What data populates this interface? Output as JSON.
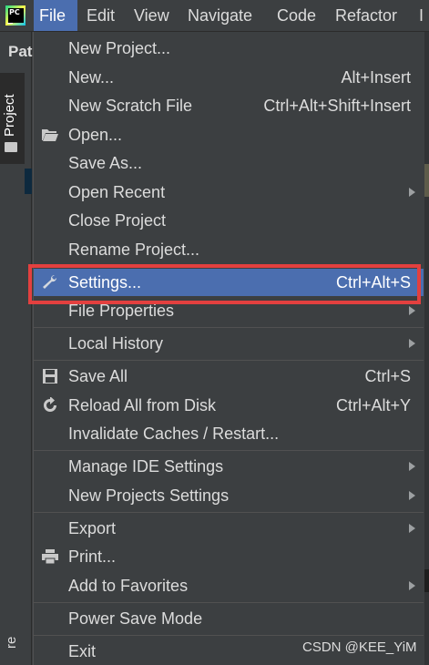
{
  "app": {
    "logo_text": "PC"
  },
  "menubar": {
    "items": [
      {
        "label": "File"
      },
      {
        "label": "Edit"
      },
      {
        "label": "View"
      },
      {
        "label": "Navigate"
      },
      {
        "label": "Code"
      },
      {
        "label": "Refactor"
      },
      {
        "label": "I"
      }
    ]
  },
  "background": {
    "pat_label": "Pat",
    "project_tab": "Project",
    "re_label": "re"
  },
  "file_menu": {
    "new_project": {
      "label": "New Project..."
    },
    "new": {
      "label": "New...",
      "shortcut": "Alt+Insert"
    },
    "new_scratch": {
      "label": "New Scratch File",
      "shortcut": "Ctrl+Alt+Shift+Insert"
    },
    "open": {
      "label": "Open...",
      "icon": "folder-open-icon"
    },
    "save_as": {
      "label": "Save As..."
    },
    "open_recent": {
      "label": "Open Recent"
    },
    "close_project": {
      "label": "Close Project"
    },
    "rename_project": {
      "label": "Rename Project..."
    },
    "settings": {
      "label": "Settings...",
      "shortcut": "Ctrl+Alt+S",
      "icon": "wrench-icon"
    },
    "file_properties": {
      "label": "File Properties"
    },
    "local_history": {
      "label": "Local History"
    },
    "save_all": {
      "label": "Save All",
      "shortcut": "Ctrl+S",
      "icon": "save-icon"
    },
    "reload_all": {
      "label": "Reload All from Disk",
      "shortcut": "Ctrl+Alt+Y",
      "icon": "reload-icon"
    },
    "invalidate_caches": {
      "label": "Invalidate Caches / Restart..."
    },
    "manage_ide": {
      "label": "Manage IDE Settings"
    },
    "new_projects_settings": {
      "label": "New Projects Settings"
    },
    "export": {
      "label": "Export"
    },
    "print": {
      "label": "Print...",
      "icon": "printer-icon"
    },
    "add_to_favorites": {
      "label": "Add to Favorites"
    },
    "power_save": {
      "label": "Power Save Mode"
    },
    "exit": {
      "label": "Exit"
    }
  },
  "colors": {
    "selected": "#4b6eaf",
    "highlight_border": "#e3403f",
    "menu_bg": "#3c3f41"
  },
  "watermark": "CSDN @KEE_YiM"
}
